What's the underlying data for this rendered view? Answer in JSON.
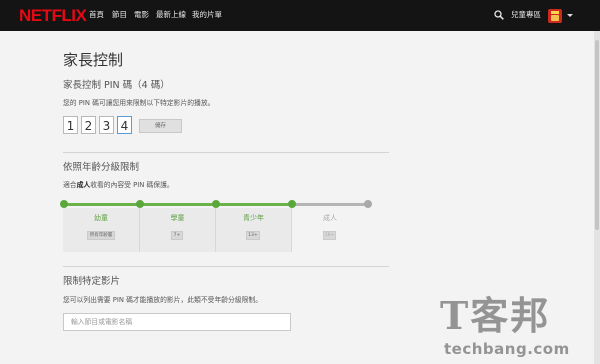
{
  "header": {
    "logo": "NETFLIX",
    "nav": [
      "首頁",
      "節目",
      "電影",
      "最新上線",
      "我的片單"
    ],
    "profile_name": "兒童專區",
    "search_icon": "search-icon",
    "profile_icon": "avatar"
  },
  "page": {
    "title": "家長控制",
    "pin_section": {
      "heading": "家長控制 PIN 碼（4 碼）",
      "description": "您的 PIN 碼可讓您用來限制以下特定影片的播放。",
      "digits": [
        "1",
        "2",
        "3",
        "4"
      ],
      "save_label": "儲存"
    },
    "rating_section": {
      "heading": "依照年齡分級限制",
      "description_prefix": "適合",
      "description_bold": "成人",
      "description_suffix": "收看的內容受 PIN 碼保護。",
      "levels": [
        {
          "label": "幼童",
          "badge": "所有年齡層",
          "enabled": true
        },
        {
          "label": "學童",
          "badge": "7+",
          "enabled": true
        },
        {
          "label": "青少年",
          "badge": "13+",
          "enabled": true
        },
        {
          "label": "成人",
          "badge": "16+",
          "enabled": false
        }
      ]
    },
    "title_section": {
      "heading": "限制特定影片",
      "description": "您可以列出需要 PIN 碼才能播放的影片，此類不受年齡分級限制。",
      "input_placeholder": "輸入節目或電影名稱"
    }
  },
  "watermark": {
    "big": "T客邦",
    "small": "techbang.com"
  },
  "colors": {
    "brand": "#e50914",
    "topbar": "#141414",
    "active_level": "#5aa83c",
    "inactive_level": "#a9a9a9"
  }
}
